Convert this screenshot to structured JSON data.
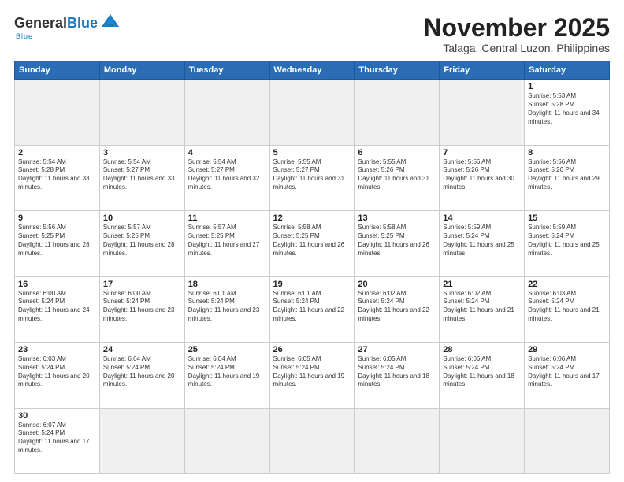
{
  "header": {
    "logo_general": "General",
    "logo_blue": "Blue",
    "logo_underline": "Blue",
    "month_title": "November 2025",
    "location": "Talaga, Central Luzon, Philippines"
  },
  "weekdays": [
    "Sunday",
    "Monday",
    "Tuesday",
    "Wednesday",
    "Thursday",
    "Friday",
    "Saturday"
  ],
  "weeks": [
    [
      {
        "day": "",
        "empty": true
      },
      {
        "day": "",
        "empty": true
      },
      {
        "day": "",
        "empty": true
      },
      {
        "day": "",
        "empty": true
      },
      {
        "day": "",
        "empty": true
      },
      {
        "day": "",
        "empty": true
      },
      {
        "day": "1",
        "sunrise": "5:53 AM",
        "sunset": "5:28 PM",
        "daylight": "11 hours and 34 minutes."
      }
    ],
    [
      {
        "day": "2",
        "sunrise": "5:54 AM",
        "sunset": "5:28 PM",
        "daylight": "11 hours and 33 minutes."
      },
      {
        "day": "3",
        "sunrise": "5:54 AM",
        "sunset": "5:27 PM",
        "daylight": "11 hours and 33 minutes."
      },
      {
        "day": "4",
        "sunrise": "5:54 AM",
        "sunset": "5:27 PM",
        "daylight": "11 hours and 32 minutes."
      },
      {
        "day": "5",
        "sunrise": "5:55 AM",
        "sunset": "5:27 PM",
        "daylight": "11 hours and 31 minutes."
      },
      {
        "day": "6",
        "sunrise": "5:55 AM",
        "sunset": "5:26 PM",
        "daylight": "11 hours and 31 minutes."
      },
      {
        "day": "7",
        "sunrise": "5:56 AM",
        "sunset": "5:26 PM",
        "daylight": "11 hours and 30 minutes."
      },
      {
        "day": "8",
        "sunrise": "5:56 AM",
        "sunset": "5:26 PM",
        "daylight": "11 hours and 29 minutes."
      }
    ],
    [
      {
        "day": "9",
        "sunrise": "5:56 AM",
        "sunset": "5:25 PM",
        "daylight": "11 hours and 28 minutes."
      },
      {
        "day": "10",
        "sunrise": "5:57 AM",
        "sunset": "5:25 PM",
        "daylight": "11 hours and 28 minutes."
      },
      {
        "day": "11",
        "sunrise": "5:57 AM",
        "sunset": "5:25 PM",
        "daylight": "11 hours and 27 minutes."
      },
      {
        "day": "12",
        "sunrise": "5:58 AM",
        "sunset": "5:25 PM",
        "daylight": "11 hours and 26 minutes."
      },
      {
        "day": "13",
        "sunrise": "5:58 AM",
        "sunset": "5:25 PM",
        "daylight": "11 hours and 26 minutes."
      },
      {
        "day": "14",
        "sunrise": "5:59 AM",
        "sunset": "5:24 PM",
        "daylight": "11 hours and 25 minutes."
      },
      {
        "day": "15",
        "sunrise": "5:59 AM",
        "sunset": "5:24 PM",
        "daylight": "11 hours and 25 minutes."
      }
    ],
    [
      {
        "day": "16",
        "sunrise": "6:00 AM",
        "sunset": "5:24 PM",
        "daylight": "11 hours and 24 minutes."
      },
      {
        "day": "17",
        "sunrise": "6:00 AM",
        "sunset": "5:24 PM",
        "daylight": "11 hours and 23 minutes."
      },
      {
        "day": "18",
        "sunrise": "6:01 AM",
        "sunset": "5:24 PM",
        "daylight": "11 hours and 23 minutes."
      },
      {
        "day": "19",
        "sunrise": "6:01 AM",
        "sunset": "5:24 PM",
        "daylight": "11 hours and 22 minutes."
      },
      {
        "day": "20",
        "sunrise": "6:02 AM",
        "sunset": "5:24 PM",
        "daylight": "11 hours and 22 minutes."
      },
      {
        "day": "21",
        "sunrise": "6:02 AM",
        "sunset": "5:24 PM",
        "daylight": "11 hours and 21 minutes."
      },
      {
        "day": "22",
        "sunrise": "6:03 AM",
        "sunset": "5:24 PM",
        "daylight": "11 hours and 21 minutes."
      }
    ],
    [
      {
        "day": "23",
        "sunrise": "6:03 AM",
        "sunset": "5:24 PM",
        "daylight": "11 hours and 20 minutes."
      },
      {
        "day": "24",
        "sunrise": "6:04 AM",
        "sunset": "5:24 PM",
        "daylight": "11 hours and 20 minutes."
      },
      {
        "day": "25",
        "sunrise": "6:04 AM",
        "sunset": "5:24 PM",
        "daylight": "11 hours and 19 minutes."
      },
      {
        "day": "26",
        "sunrise": "6:05 AM",
        "sunset": "5:24 PM",
        "daylight": "11 hours and 19 minutes."
      },
      {
        "day": "27",
        "sunrise": "6:05 AM",
        "sunset": "5:24 PM",
        "daylight": "11 hours and 18 minutes."
      },
      {
        "day": "28",
        "sunrise": "6:06 AM",
        "sunset": "5:24 PM",
        "daylight": "11 hours and 18 minutes."
      },
      {
        "day": "29",
        "sunrise": "6:06 AM",
        "sunset": "5:24 PM",
        "daylight": "11 hours and 17 minutes."
      }
    ],
    [
      {
        "day": "30",
        "sunrise": "6:07 AM",
        "sunset": "5:24 PM",
        "daylight": "11 hours and 17 minutes."
      },
      {
        "day": "",
        "empty": true
      },
      {
        "day": "",
        "empty": true
      },
      {
        "day": "",
        "empty": true
      },
      {
        "day": "",
        "empty": true
      },
      {
        "day": "",
        "empty": true
      },
      {
        "day": "",
        "empty": true
      }
    ]
  ],
  "labels": {
    "sunrise_prefix": "Sunrise: ",
    "sunset_prefix": "Sunset: ",
    "daylight_prefix": "Daylight: "
  }
}
